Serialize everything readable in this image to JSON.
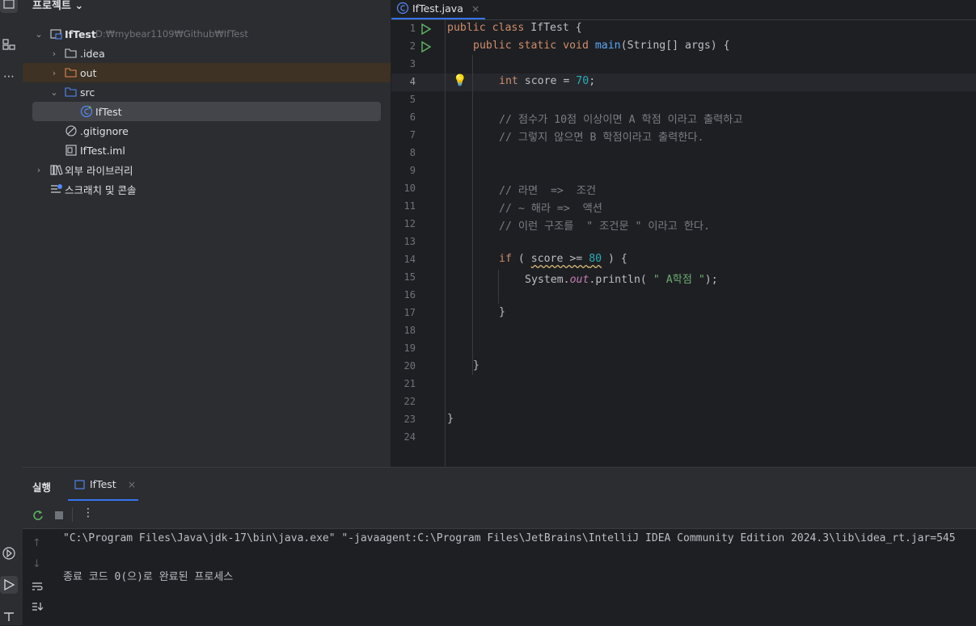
{
  "project_panel": {
    "title": "프로젝트 ⌄",
    "tree": [
      {
        "label": "IfTest",
        "path": "D:₩mybear1109₩Github₩IfTest"
      },
      {
        "label": ".idea"
      },
      {
        "label": "out"
      },
      {
        "label": "src"
      },
      {
        "label": "IfTest"
      },
      {
        "label": ".gitignore"
      },
      {
        "label": "IfTest.iml"
      },
      {
        "label": "외부 라이브러리"
      },
      {
        "label": "스크래치 및 콘솔"
      }
    ]
  },
  "editor": {
    "tab_label": "IfTest.java",
    "line_numbers": [
      "1",
      "2",
      "3",
      "4",
      "5",
      "6",
      "7",
      "8",
      "9",
      "10",
      "11",
      "12",
      "13",
      "14",
      "15",
      "16",
      "17",
      "18",
      "19",
      "20",
      "21",
      "22",
      "23",
      "24"
    ],
    "current_line": "4",
    "code": {
      "l1": {
        "kw1": "public class ",
        "rest": "IfTest {"
      },
      "l2": {
        "kw1": "public static void ",
        "fn": "main",
        "rest": "(String[] args) {"
      },
      "l4": {
        "kw1": "int ",
        "var": "score = ",
        "num": "70",
        "end": ";"
      },
      "l6": "// 점수가 10점 이상이면 A 학점 이라고 출력하고",
      "l7": "// 그렇지 않으면 B 학점이라고 출력한다.",
      "l10": "// 라면  =>  조건",
      "l11": "// ~ 해라 =>  액션",
      "l12": "// 이런 구조를  \" 조건문 \" 이라고 한다.",
      "l14": {
        "kw1": "if ",
        "open": "( ",
        "cond": "score >= ",
        "num": "80",
        "close": " ) {"
      },
      "l15": {
        "pre": "System.",
        "fld": "out",
        "mid": ".println( ",
        "str": "\" A학점 \"",
        "end": ");"
      },
      "l17": "}",
      "l20": "}",
      "l23": "}"
    }
  },
  "run_panel": {
    "title": "실행",
    "tab_label": "IfTest",
    "console": [
      "\"C:\\Program Files\\Java\\jdk-17\\bin\\java.exe\" \"-javaagent:C:\\Program Files\\JetBrains\\IntelliJ IDEA Community Edition 2024.3\\lib\\idea_rt.jar=545",
      "종료 코드 0(으)로 완료된 프로세스"
    ]
  },
  "colors": {
    "accent": "#3574f0",
    "keyword": "#cf8e6d",
    "function": "#56a8f5",
    "number": "#2aacb8",
    "comment": "#7a7e85",
    "string": "#6aab73"
  }
}
